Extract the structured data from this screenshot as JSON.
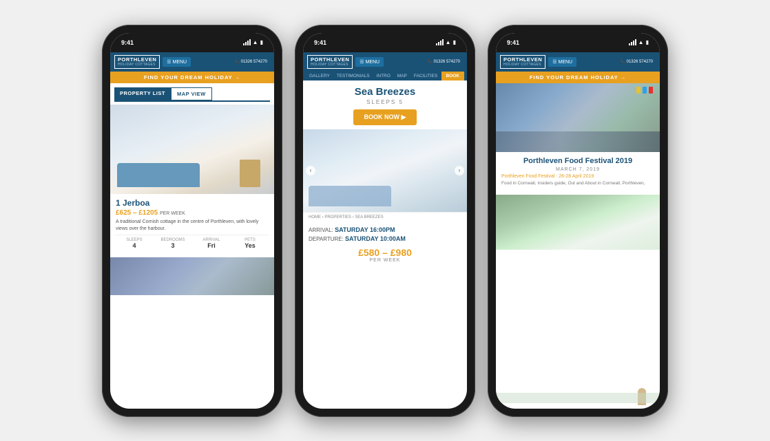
{
  "phones": [
    {
      "id": "phone1",
      "status_time": "9:41",
      "header": {
        "logo_title": "PORTHLEVEN",
        "logo_sub": "HOLIDAY COTTAGES",
        "menu_label": "☰ MENU",
        "phone_label": "📞 01326 574270"
      },
      "banner": "FIND YOUR DREAM HOLIDAY →",
      "tabs": [
        {
          "label": "PROPERTY LIST",
          "active": true
        },
        {
          "label": "MAP VIEW",
          "active": false
        }
      ],
      "property": {
        "name": "1 Jerboa",
        "price": "£625 – £1205",
        "price_suffix": "PER WEEK",
        "description": "A traditional Cornish cottage in the centre of Porthleven, with lovely views over the harbour.",
        "meta": [
          {
            "label": "SLEEPS",
            "value": "4"
          },
          {
            "label": "BEDROOMS",
            "value": "3"
          },
          {
            "label": "ARRIVAL",
            "value": "Fri"
          },
          {
            "label": "PETS",
            "value": "Yes"
          }
        ]
      }
    },
    {
      "id": "phone2",
      "status_time": "9:41",
      "header": {
        "logo_title": "PORTHLEVEN",
        "logo_sub": "HOLIDAY COTTAGES",
        "menu_label": "☰ MENU",
        "phone_label": "📞 01326 574270"
      },
      "nav_tabs": [
        "GALLERY",
        "TESTIMONIALS",
        "INTRO",
        "MAP",
        "FACILITIES",
        "BOOK"
      ],
      "property_title": "Sea Breezes",
      "property_sub": "SLEEPS 5",
      "book_now": "BOOK NOW ▶",
      "breadcrumb": "HOME › PROPERTIES › SEA BREEZES",
      "arrival_label": "ARRIVAL:",
      "arrival_value": "SATURDAY 16:00PM",
      "departure_label": "DEPARTURE:",
      "departure_value": "SATURDAY 10:00AM",
      "price_range": "£580 – £980",
      "per_week": "PER WEEK"
    },
    {
      "id": "phone3",
      "status_time": "9:41",
      "header": {
        "logo_title": "PORTHLEVEN",
        "logo_sub": "HOLIDAY COTTAGES",
        "menu_label": "☰ MENU",
        "phone_label": "📞 01326 574270"
      },
      "banner": "FIND YOUR DREAM HOLIDAY →",
      "festival": {
        "title": "Porthleven Food Festival 2019",
        "date": "MARCH 7, 2019",
        "subtitle": "Porthleven Food Festival : 26-28 April 2019",
        "description": "Food in Cornwall, Insiders guide, Out and About in Cornwall, Porthleven,"
      }
    }
  ]
}
